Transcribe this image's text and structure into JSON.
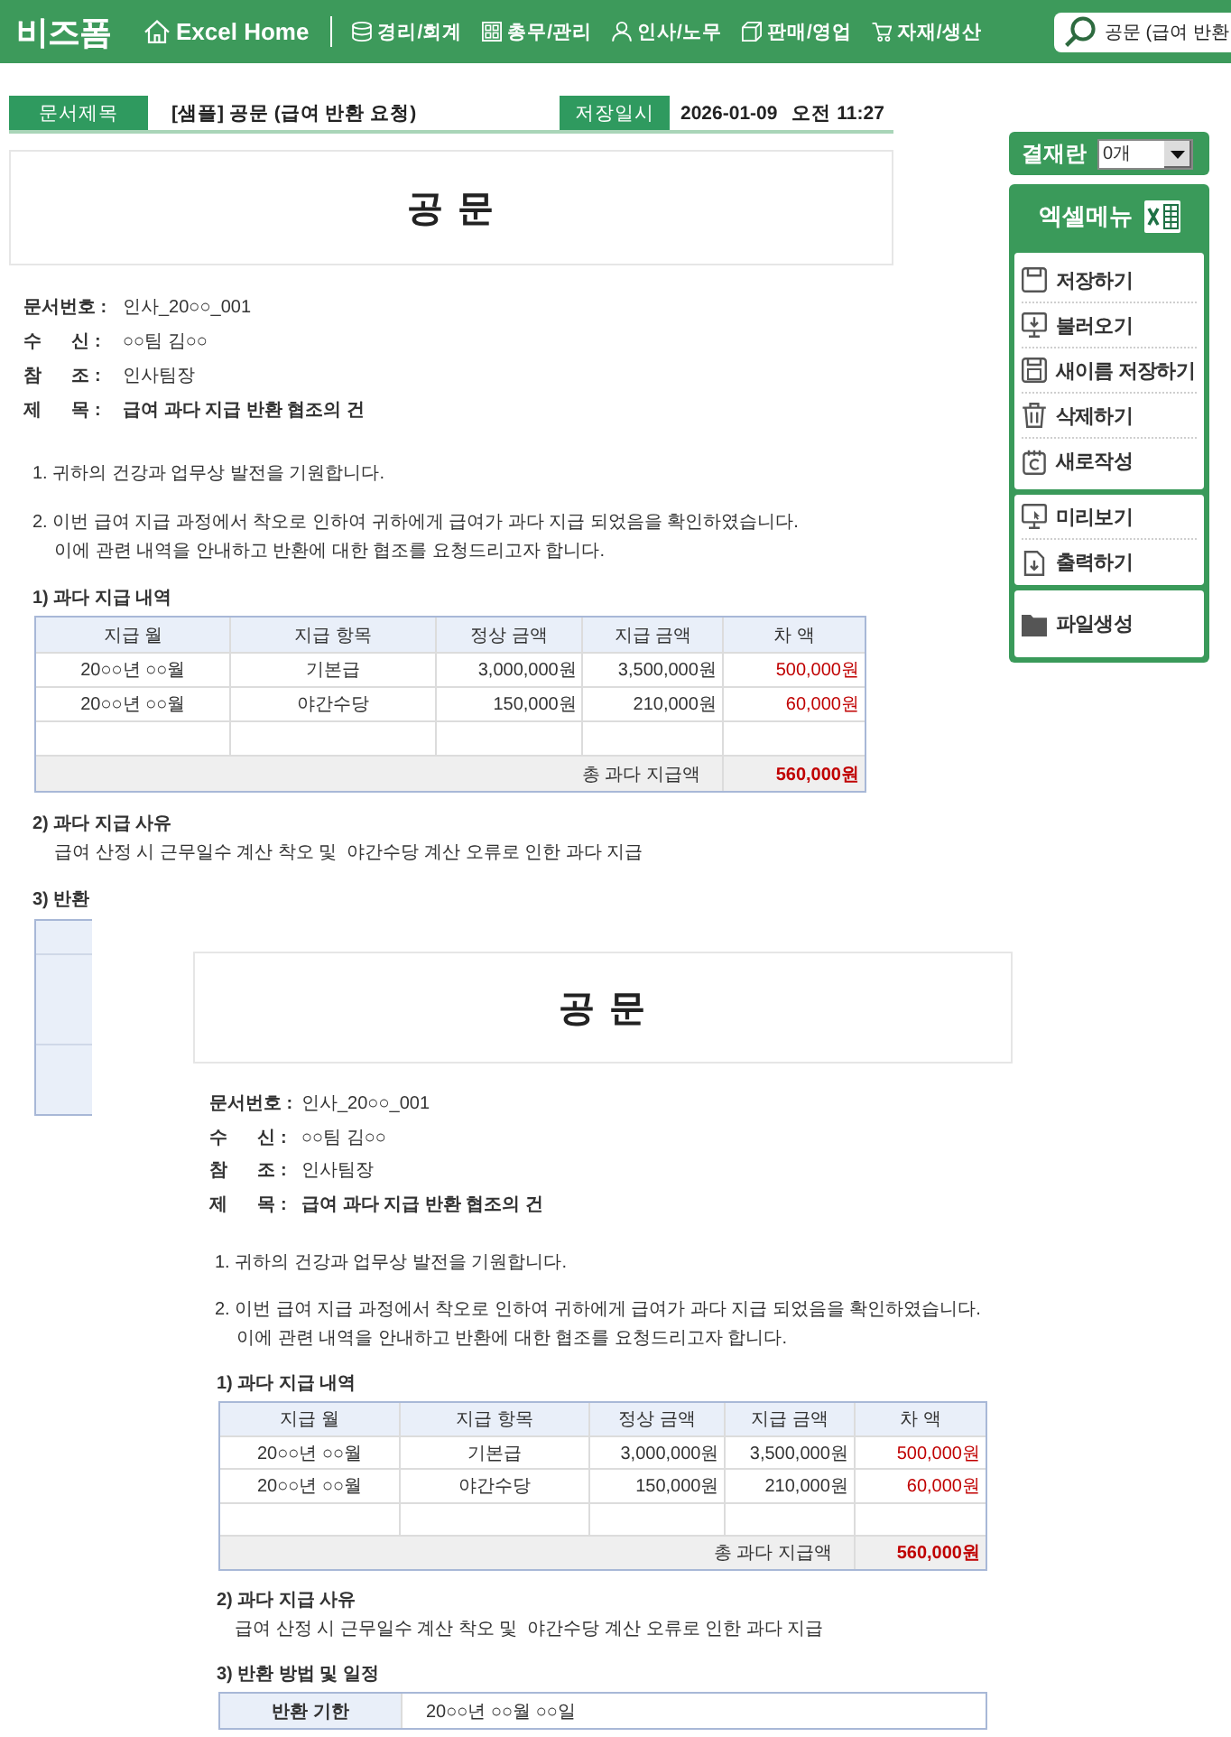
{
  "nav": {
    "logo": "비즈폼",
    "home": "Excel Home",
    "menus": [
      "경리/회계",
      "총무/관리",
      "인사/노무",
      "판매/영업",
      "자재/생산"
    ],
    "search": {
      "value": "공문 (급여 반환"
    }
  },
  "doc_header": {
    "title_label": "문서제목",
    "title": "[샘플] 공문 (급여 반환 요청)",
    "date_label": "저장일시",
    "date": "2026-01-09",
    "time": "오전 11:27"
  },
  "sidebar": {
    "approval": {
      "label": "결재란",
      "value": "0개"
    },
    "excel_menu": {
      "title": "엑셀메뉴",
      "groups": [
        [
          "저장하기",
          "불러오기",
          "새이름 저장하기",
          "삭제하기",
          "새로작성"
        ],
        [
          "미리보기",
          "출력하기"
        ],
        [
          "파일생성"
        ]
      ]
    }
  },
  "document": {
    "heading": "공 문",
    "fields": [
      {
        "label": "문서번호 :",
        "value": "인사_20○○_001",
        "bold": false
      },
      {
        "label": "수      신 :",
        "value": "○○팀 김○○",
        "bold": false
      },
      {
        "label": "참      조 :",
        "value": "인사팀장",
        "bold": false
      },
      {
        "label": "제      목 :",
        "value": "급여 과다 지급 반환 협조의 건",
        "bold": true
      }
    ],
    "paragraphs": [
      [
        "1. 귀하의 건강과 업무상 발전을 기원합니다."
      ],
      [
        "2. 이번 급여 지급 과정에서 착오로 인하여 귀하에게 급여가 과다 지급 되었음을 확인하였습니다.",
        "이에 관련 내역을 안내하고 반환에 대한 협조를 요청드리고자 합니다."
      ]
    ],
    "sections": [
      {
        "kind": "table",
        "heading": "1) 과다 지급 내역",
        "columns": [
          {
            "label": "지급 월",
            "kind": "text"
          },
          {
            "label": "지급 항목",
            "kind": "text"
          },
          {
            "label": "정상 금액",
            "kind": "amount"
          },
          {
            "label": "지급 금액",
            "kind": "amount"
          },
          {
            "label": "차 액",
            "kind": "difference"
          }
        ],
        "rows": [
          [
            "20○○년 ○○월",
            "기본급",
            "3,000,000원",
            "3,500,000원",
            "500,000원"
          ],
          [
            "20○○년 ○○월",
            "야간수당",
            "150,000원",
            "210,000원",
            "60,000원"
          ]
        ],
        "total": {
          "label": "총 과다 지급액",
          "value": "560,000원"
        }
      },
      {
        "kind": "text",
        "heading": "2) 과다 지급 사유",
        "text": "급여 산정 시 근무일수 계산 착오 및  야간수당 계산 오류로 인한 과다 지급"
      },
      {
        "kind": "covered",
        "heading": "3) 반환"
      }
    ]
  },
  "preview": {
    "heading": "공 문",
    "fields": [
      {
        "label": "문서번호 :",
        "value": "인사_20○○_001",
        "bold": false
      },
      {
        "label": "수      신 :",
        "value": "○○팀 김○○",
        "bold": false
      },
      {
        "label": "참      조 :",
        "value": "인사팀장",
        "bold": false
      },
      {
        "label": "제      목 :",
        "value": "급여 과다 지급 반환 협조의 건",
        "bold": true
      }
    ],
    "paragraphs": [
      [
        "1. 귀하의 건강과 업무상 발전을 기원합니다."
      ],
      [
        "2. 이번 급여 지급 과정에서 착오로 인하여 귀하에게 급여가 과다 지급 되었음을 확인하였습니다.",
        "이에 관련 내역을 안내하고 반환에 대한 협조를 요청드리고자 합니다."
      ]
    ],
    "sections": [
      {
        "kind": "table",
        "heading": "1) 과다 지급 내역",
        "columns": [
          {
            "label": "지급 월",
            "kind": "text"
          },
          {
            "label": "지급 항목",
            "kind": "text"
          },
          {
            "label": "정상 금액",
            "kind": "amount"
          },
          {
            "label": "지급 금액",
            "kind": "amount"
          },
          {
            "label": "차 액",
            "kind": "difference"
          }
        ],
        "rows": [
          [
            "20○○년 ○○월",
            "기본급",
            "3,000,000원",
            "3,500,000원",
            "500,000원"
          ],
          [
            "20○○년 ○○월",
            "야간수당",
            "150,000원",
            "210,000원",
            "60,000원"
          ]
        ],
        "total": {
          "label": "총 과다 지급액",
          "value": "560,000원"
        }
      },
      {
        "kind": "text",
        "heading": "2) 과다 지급 사유",
        "text": "급여 산정 시 근무일수 계산 착오 및  야간수당 계산 오류로 인한 과다 지급"
      },
      {
        "kind": "schedule",
        "heading": "3) 반환 방법 및 일정",
        "rows": [
          {
            "label": "반환 기한",
            "value": "20○○년 ○○월 ○○일"
          }
        ]
      }
    ]
  }
}
